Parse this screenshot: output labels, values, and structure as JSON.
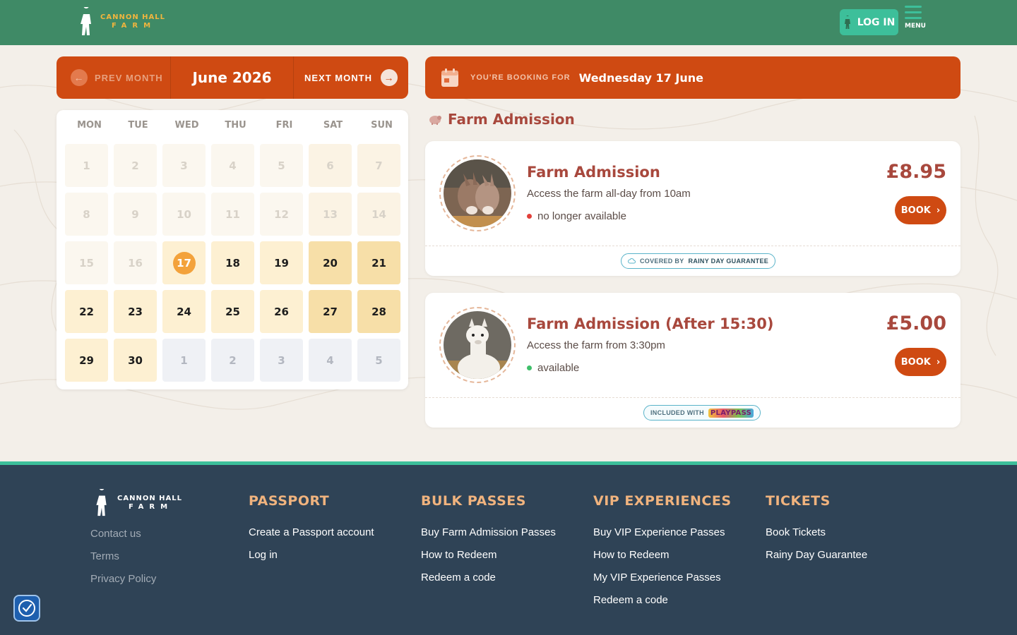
{
  "header": {
    "logo_line1": "CANNON HALL",
    "logo_line2": "FARM",
    "login_label": "LOG IN",
    "menu_label": "MENU",
    "colors": {
      "bar": "#3f8a66",
      "accent": "#3dbf9a",
      "logo": "#f0b53e"
    }
  },
  "month_nav": {
    "prev_label": "PREV MONTH",
    "title": "June 2026",
    "next_label": "NEXT MONTH",
    "color": "#cf4a12"
  },
  "calendar": {
    "weekdays": [
      "MON",
      "TUE",
      "WED",
      "THU",
      "FRI",
      "SAT",
      "SUN"
    ],
    "days": [
      {
        "label": "1",
        "state": "past"
      },
      {
        "label": "2",
        "state": "past"
      },
      {
        "label": "3",
        "state": "past"
      },
      {
        "label": "4",
        "state": "past"
      },
      {
        "label": "5",
        "state": "past"
      },
      {
        "label": "6",
        "state": "past"
      },
      {
        "label": "7",
        "state": "past"
      },
      {
        "label": "8",
        "state": "past"
      },
      {
        "label": "9",
        "state": "past"
      },
      {
        "label": "10",
        "state": "past"
      },
      {
        "label": "11",
        "state": "past"
      },
      {
        "label": "12",
        "state": "past"
      },
      {
        "label": "13",
        "state": "past"
      },
      {
        "label": "14",
        "state": "past"
      },
      {
        "label": "15",
        "state": "past"
      },
      {
        "label": "16",
        "state": "past"
      },
      {
        "label": "17",
        "state": "selected"
      },
      {
        "label": "18",
        "state": "available"
      },
      {
        "label": "19",
        "state": "available"
      },
      {
        "label": "20",
        "state": "available"
      },
      {
        "label": "21",
        "state": "available"
      },
      {
        "label": "22",
        "state": "available"
      },
      {
        "label": "23",
        "state": "available"
      },
      {
        "label": "24",
        "state": "available"
      },
      {
        "label": "25",
        "state": "available"
      },
      {
        "label": "26",
        "state": "available"
      },
      {
        "label": "27",
        "state": "available"
      },
      {
        "label": "28",
        "state": "available"
      },
      {
        "label": "29",
        "state": "available"
      },
      {
        "label": "30",
        "state": "available"
      },
      {
        "label": "1",
        "state": "next"
      },
      {
        "label": "2",
        "state": "next"
      },
      {
        "label": "3",
        "state": "next"
      },
      {
        "label": "4",
        "state": "next"
      },
      {
        "label": "5",
        "state": "next"
      }
    ]
  },
  "booking": {
    "for_label": "YOU'RE BOOKING FOR",
    "date": "Wednesday 17 June"
  },
  "section_title": "Farm Admission",
  "tickets": [
    {
      "title": "Farm Admission",
      "description": "Access the farm all-day from 10am",
      "status": "no longer available",
      "status_color": "red",
      "price": "£8.95",
      "book_label": "BOOK",
      "photo_icon": "donkeys-photo",
      "badge_prefix": "COVERED BY",
      "badge_strong": "RAINY DAY GUARANTEE"
    },
    {
      "title": "Farm Admission (After 15:30)",
      "description": "Access the farm from 3:30pm",
      "status": "available",
      "status_color": "green",
      "price": "£5.00",
      "book_label": "BOOK",
      "photo_icon": "alpaca-photo",
      "badge_prefix": "INCLUDED WITH",
      "badge_logo": "PLAYPASS"
    }
  ],
  "footer": {
    "logo_line1": "CANNON HALL",
    "logo_line2": "FARM",
    "left_links": [
      "Contact us",
      "Terms",
      "Privacy Policy"
    ],
    "columns": [
      {
        "heading": "PASSPORT",
        "links": [
          "Create a Passport account",
          "Log in"
        ]
      },
      {
        "heading": "BULK PASSES",
        "links": [
          "Buy Farm Admission Passes",
          "How to Redeem",
          "Redeem a code"
        ]
      },
      {
        "heading": "VIP EXPERIENCES",
        "links": [
          "Buy VIP Experience Passes",
          "How to Redeem",
          "My VIP Experience Passes",
          "Redeem a code"
        ]
      },
      {
        "heading": "TICKETS",
        "links": [
          "Book Tickets",
          "Rainy Day Guarantee"
        ]
      }
    ]
  }
}
